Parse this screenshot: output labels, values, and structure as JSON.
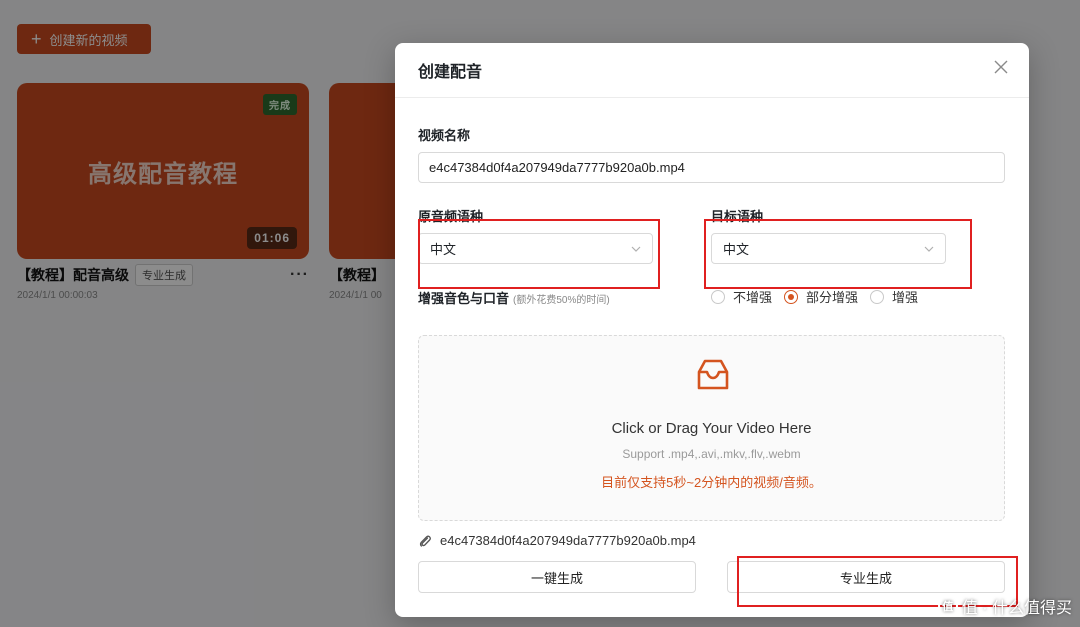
{
  "background": {
    "create_button_label": "创建新的视频",
    "cards": [
      {
        "thumb_title": "高级配音教程",
        "status": "完成",
        "duration": "01:06",
        "title": "【教程】配音高级",
        "tag": "专业生成",
        "date": "2024/1/1 00:00:03"
      },
      {
        "title": "【教程】",
        "date": "2024/1/1 00"
      }
    ]
  },
  "modal": {
    "title": "创建配音",
    "video_name_label": "视频名称",
    "video_name_value": "e4c47384d0f4a207949da7777b920a0b.mp4",
    "source_lang_label": "原音频语种",
    "source_lang_value": "中文",
    "target_lang_label": "目标语种",
    "target_lang_value": "中文",
    "enhance_label": "增强音色与口音",
    "enhance_hint": "(额外花费50%的时间)",
    "enhance_options": [
      "不增强",
      "部分增强",
      "增强"
    ],
    "enhance_selected": "部分增强",
    "upload_title": "Click or Drag Your Video Here",
    "upload_sub": "Support .mp4,.avi,.mkv,.flv,.webm",
    "upload_note": "目前仅支持5秒~2分钟内的视频/音频。",
    "file_name": "e4c47384d0f4a207949da7777b920a0b.mp4",
    "btn_quick": "一键生成",
    "btn_pro": "专业生成"
  },
  "watermark": "值 · 什么值得买",
  "colors": {
    "accent": "#d4541f",
    "highlight": "#e02020",
    "card": "#c84a1f"
  }
}
